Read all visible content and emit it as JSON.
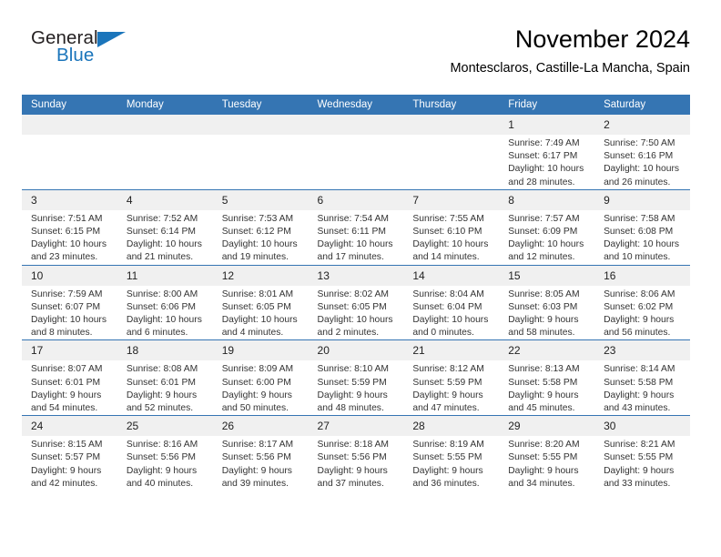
{
  "brand": {
    "word1": "General",
    "word2": "Blue",
    "triangle_color": "#1b75bb"
  },
  "header": {
    "title": "November 2024",
    "subtitle": "Montesclaros, Castille-La Mancha, Spain"
  },
  "theme": {
    "header_bg": "#3575b3",
    "daynum_bg": "#f0f0f0",
    "grid_line": "#3575b3"
  },
  "weekday_headers": [
    "Sunday",
    "Monday",
    "Tuesday",
    "Wednesday",
    "Thursday",
    "Friday",
    "Saturday"
  ],
  "labels": {
    "sunrise_prefix": "Sunrise:",
    "sunset_prefix": "Sunset:",
    "daylight_prefix": "Daylight:"
  },
  "weeks": [
    [
      {
        "day": "",
        "empty": true
      },
      {
        "day": "",
        "empty": true
      },
      {
        "day": "",
        "empty": true
      },
      {
        "day": "",
        "empty": true
      },
      {
        "day": "",
        "empty": true
      },
      {
        "day": "1",
        "sunrise": "Sunrise: 7:49 AM",
        "sunset": "Sunset: 6:17 PM",
        "daylight_1": "Daylight: 10 hours",
        "daylight_2": "and 28 minutes."
      },
      {
        "day": "2",
        "sunrise": "Sunrise: 7:50 AM",
        "sunset": "Sunset: 6:16 PM",
        "daylight_1": "Daylight: 10 hours",
        "daylight_2": "and 26 minutes."
      }
    ],
    [
      {
        "day": "3",
        "sunrise": "Sunrise: 7:51 AM",
        "sunset": "Sunset: 6:15 PM",
        "daylight_1": "Daylight: 10 hours",
        "daylight_2": "and 23 minutes."
      },
      {
        "day": "4",
        "sunrise": "Sunrise: 7:52 AM",
        "sunset": "Sunset: 6:14 PM",
        "daylight_1": "Daylight: 10 hours",
        "daylight_2": "and 21 minutes."
      },
      {
        "day": "5",
        "sunrise": "Sunrise: 7:53 AM",
        "sunset": "Sunset: 6:12 PM",
        "daylight_1": "Daylight: 10 hours",
        "daylight_2": "and 19 minutes."
      },
      {
        "day": "6",
        "sunrise": "Sunrise: 7:54 AM",
        "sunset": "Sunset: 6:11 PM",
        "daylight_1": "Daylight: 10 hours",
        "daylight_2": "and 17 minutes."
      },
      {
        "day": "7",
        "sunrise": "Sunrise: 7:55 AM",
        "sunset": "Sunset: 6:10 PM",
        "daylight_1": "Daylight: 10 hours",
        "daylight_2": "and 14 minutes."
      },
      {
        "day": "8",
        "sunrise": "Sunrise: 7:57 AM",
        "sunset": "Sunset: 6:09 PM",
        "daylight_1": "Daylight: 10 hours",
        "daylight_2": "and 12 minutes."
      },
      {
        "day": "9",
        "sunrise": "Sunrise: 7:58 AM",
        "sunset": "Sunset: 6:08 PM",
        "daylight_1": "Daylight: 10 hours",
        "daylight_2": "and 10 minutes."
      }
    ],
    [
      {
        "day": "10",
        "sunrise": "Sunrise: 7:59 AM",
        "sunset": "Sunset: 6:07 PM",
        "daylight_1": "Daylight: 10 hours",
        "daylight_2": "and 8 minutes."
      },
      {
        "day": "11",
        "sunrise": "Sunrise: 8:00 AM",
        "sunset": "Sunset: 6:06 PM",
        "daylight_1": "Daylight: 10 hours",
        "daylight_2": "and 6 minutes."
      },
      {
        "day": "12",
        "sunrise": "Sunrise: 8:01 AM",
        "sunset": "Sunset: 6:05 PM",
        "daylight_1": "Daylight: 10 hours",
        "daylight_2": "and 4 minutes."
      },
      {
        "day": "13",
        "sunrise": "Sunrise: 8:02 AM",
        "sunset": "Sunset: 6:05 PM",
        "daylight_1": "Daylight: 10 hours",
        "daylight_2": "and 2 minutes."
      },
      {
        "day": "14",
        "sunrise": "Sunrise: 8:04 AM",
        "sunset": "Sunset: 6:04 PM",
        "daylight_1": "Daylight: 10 hours",
        "daylight_2": "and 0 minutes."
      },
      {
        "day": "15",
        "sunrise": "Sunrise: 8:05 AM",
        "sunset": "Sunset: 6:03 PM",
        "daylight_1": "Daylight: 9 hours",
        "daylight_2": "and 58 minutes."
      },
      {
        "day": "16",
        "sunrise": "Sunrise: 8:06 AM",
        "sunset": "Sunset: 6:02 PM",
        "daylight_1": "Daylight: 9 hours",
        "daylight_2": "and 56 minutes."
      }
    ],
    [
      {
        "day": "17",
        "sunrise": "Sunrise: 8:07 AM",
        "sunset": "Sunset: 6:01 PM",
        "daylight_1": "Daylight: 9 hours",
        "daylight_2": "and 54 minutes."
      },
      {
        "day": "18",
        "sunrise": "Sunrise: 8:08 AM",
        "sunset": "Sunset: 6:01 PM",
        "daylight_1": "Daylight: 9 hours",
        "daylight_2": "and 52 minutes."
      },
      {
        "day": "19",
        "sunrise": "Sunrise: 8:09 AM",
        "sunset": "Sunset: 6:00 PM",
        "daylight_1": "Daylight: 9 hours",
        "daylight_2": "and 50 minutes."
      },
      {
        "day": "20",
        "sunrise": "Sunrise: 8:10 AM",
        "sunset": "Sunset: 5:59 PM",
        "daylight_1": "Daylight: 9 hours",
        "daylight_2": "and 48 minutes."
      },
      {
        "day": "21",
        "sunrise": "Sunrise: 8:12 AM",
        "sunset": "Sunset: 5:59 PM",
        "daylight_1": "Daylight: 9 hours",
        "daylight_2": "and 47 minutes."
      },
      {
        "day": "22",
        "sunrise": "Sunrise: 8:13 AM",
        "sunset": "Sunset: 5:58 PM",
        "daylight_1": "Daylight: 9 hours",
        "daylight_2": "and 45 minutes."
      },
      {
        "day": "23",
        "sunrise": "Sunrise: 8:14 AM",
        "sunset": "Sunset: 5:58 PM",
        "daylight_1": "Daylight: 9 hours",
        "daylight_2": "and 43 minutes."
      }
    ],
    [
      {
        "day": "24",
        "sunrise": "Sunrise: 8:15 AM",
        "sunset": "Sunset: 5:57 PM",
        "daylight_1": "Daylight: 9 hours",
        "daylight_2": "and 42 minutes."
      },
      {
        "day": "25",
        "sunrise": "Sunrise: 8:16 AM",
        "sunset": "Sunset: 5:56 PM",
        "daylight_1": "Daylight: 9 hours",
        "daylight_2": "and 40 minutes."
      },
      {
        "day": "26",
        "sunrise": "Sunrise: 8:17 AM",
        "sunset": "Sunset: 5:56 PM",
        "daylight_1": "Daylight: 9 hours",
        "daylight_2": "and 39 minutes."
      },
      {
        "day": "27",
        "sunrise": "Sunrise: 8:18 AM",
        "sunset": "Sunset: 5:56 PM",
        "daylight_1": "Daylight: 9 hours",
        "daylight_2": "and 37 minutes."
      },
      {
        "day": "28",
        "sunrise": "Sunrise: 8:19 AM",
        "sunset": "Sunset: 5:55 PM",
        "daylight_1": "Daylight: 9 hours",
        "daylight_2": "and 36 minutes."
      },
      {
        "day": "29",
        "sunrise": "Sunrise: 8:20 AM",
        "sunset": "Sunset: 5:55 PM",
        "daylight_1": "Daylight: 9 hours",
        "daylight_2": "and 34 minutes."
      },
      {
        "day": "30",
        "sunrise": "Sunrise: 8:21 AM",
        "sunset": "Sunset: 5:55 PM",
        "daylight_1": "Daylight: 9 hours",
        "daylight_2": "and 33 minutes."
      }
    ]
  ]
}
